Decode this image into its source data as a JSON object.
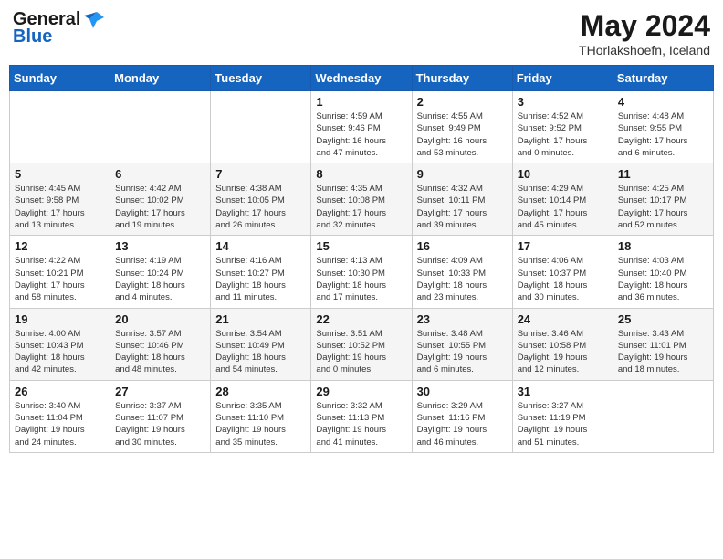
{
  "header": {
    "logo_general": "General",
    "logo_blue": "Blue",
    "month_title": "May 2024",
    "location": "THorlakshoefn, Iceland"
  },
  "days_of_week": [
    "Sunday",
    "Monday",
    "Tuesday",
    "Wednesday",
    "Thursday",
    "Friday",
    "Saturday"
  ],
  "weeks": [
    [
      {
        "day": "",
        "info": ""
      },
      {
        "day": "",
        "info": ""
      },
      {
        "day": "",
        "info": ""
      },
      {
        "day": "1",
        "info": "Sunrise: 4:59 AM\nSunset: 9:46 PM\nDaylight: 16 hours\nand 47 minutes."
      },
      {
        "day": "2",
        "info": "Sunrise: 4:55 AM\nSunset: 9:49 PM\nDaylight: 16 hours\nand 53 minutes."
      },
      {
        "day": "3",
        "info": "Sunrise: 4:52 AM\nSunset: 9:52 PM\nDaylight: 17 hours\nand 0 minutes."
      },
      {
        "day": "4",
        "info": "Sunrise: 4:48 AM\nSunset: 9:55 PM\nDaylight: 17 hours\nand 6 minutes."
      }
    ],
    [
      {
        "day": "5",
        "info": "Sunrise: 4:45 AM\nSunset: 9:58 PM\nDaylight: 17 hours\nand 13 minutes."
      },
      {
        "day": "6",
        "info": "Sunrise: 4:42 AM\nSunset: 10:02 PM\nDaylight: 17 hours\nand 19 minutes."
      },
      {
        "day": "7",
        "info": "Sunrise: 4:38 AM\nSunset: 10:05 PM\nDaylight: 17 hours\nand 26 minutes."
      },
      {
        "day": "8",
        "info": "Sunrise: 4:35 AM\nSunset: 10:08 PM\nDaylight: 17 hours\nand 32 minutes."
      },
      {
        "day": "9",
        "info": "Sunrise: 4:32 AM\nSunset: 10:11 PM\nDaylight: 17 hours\nand 39 minutes."
      },
      {
        "day": "10",
        "info": "Sunrise: 4:29 AM\nSunset: 10:14 PM\nDaylight: 17 hours\nand 45 minutes."
      },
      {
        "day": "11",
        "info": "Sunrise: 4:25 AM\nSunset: 10:17 PM\nDaylight: 17 hours\nand 52 minutes."
      }
    ],
    [
      {
        "day": "12",
        "info": "Sunrise: 4:22 AM\nSunset: 10:21 PM\nDaylight: 17 hours\nand 58 minutes."
      },
      {
        "day": "13",
        "info": "Sunrise: 4:19 AM\nSunset: 10:24 PM\nDaylight: 18 hours\nand 4 minutes."
      },
      {
        "day": "14",
        "info": "Sunrise: 4:16 AM\nSunset: 10:27 PM\nDaylight: 18 hours\nand 11 minutes."
      },
      {
        "day": "15",
        "info": "Sunrise: 4:13 AM\nSunset: 10:30 PM\nDaylight: 18 hours\nand 17 minutes."
      },
      {
        "day": "16",
        "info": "Sunrise: 4:09 AM\nSunset: 10:33 PM\nDaylight: 18 hours\nand 23 minutes."
      },
      {
        "day": "17",
        "info": "Sunrise: 4:06 AM\nSunset: 10:37 PM\nDaylight: 18 hours\nand 30 minutes."
      },
      {
        "day": "18",
        "info": "Sunrise: 4:03 AM\nSunset: 10:40 PM\nDaylight: 18 hours\nand 36 minutes."
      }
    ],
    [
      {
        "day": "19",
        "info": "Sunrise: 4:00 AM\nSunset: 10:43 PM\nDaylight: 18 hours\nand 42 minutes."
      },
      {
        "day": "20",
        "info": "Sunrise: 3:57 AM\nSunset: 10:46 PM\nDaylight: 18 hours\nand 48 minutes."
      },
      {
        "day": "21",
        "info": "Sunrise: 3:54 AM\nSunset: 10:49 PM\nDaylight: 18 hours\nand 54 minutes."
      },
      {
        "day": "22",
        "info": "Sunrise: 3:51 AM\nSunset: 10:52 PM\nDaylight: 19 hours\nand 0 minutes."
      },
      {
        "day": "23",
        "info": "Sunrise: 3:48 AM\nSunset: 10:55 PM\nDaylight: 19 hours\nand 6 minutes."
      },
      {
        "day": "24",
        "info": "Sunrise: 3:46 AM\nSunset: 10:58 PM\nDaylight: 19 hours\nand 12 minutes."
      },
      {
        "day": "25",
        "info": "Sunrise: 3:43 AM\nSunset: 11:01 PM\nDaylight: 19 hours\nand 18 minutes."
      }
    ],
    [
      {
        "day": "26",
        "info": "Sunrise: 3:40 AM\nSunset: 11:04 PM\nDaylight: 19 hours\nand 24 minutes."
      },
      {
        "day": "27",
        "info": "Sunrise: 3:37 AM\nSunset: 11:07 PM\nDaylight: 19 hours\nand 30 minutes."
      },
      {
        "day": "28",
        "info": "Sunrise: 3:35 AM\nSunset: 11:10 PM\nDaylight: 19 hours\nand 35 minutes."
      },
      {
        "day": "29",
        "info": "Sunrise: 3:32 AM\nSunset: 11:13 PM\nDaylight: 19 hours\nand 41 minutes."
      },
      {
        "day": "30",
        "info": "Sunrise: 3:29 AM\nSunset: 11:16 PM\nDaylight: 19 hours\nand 46 minutes."
      },
      {
        "day": "31",
        "info": "Sunrise: 3:27 AM\nSunset: 11:19 PM\nDaylight: 19 hours\nand 51 minutes."
      },
      {
        "day": "",
        "info": ""
      }
    ]
  ]
}
